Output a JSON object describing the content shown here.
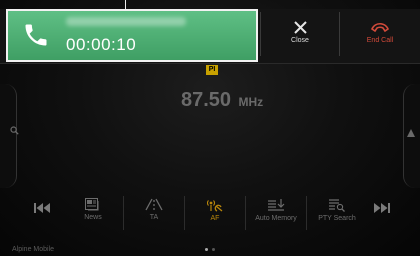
{
  "call": {
    "timer": "00:00:10"
  },
  "top_actions": {
    "close_label": "Close",
    "end_call_label": "End Call"
  },
  "radio": {
    "pi_badge": "PI",
    "frequency": "87.50",
    "unit": "MHz"
  },
  "functions": [
    {
      "label": "News",
      "icon": "news-icon",
      "active": false
    },
    {
      "label": "TA",
      "icon": "ta-icon",
      "active": false
    },
    {
      "label": "AF",
      "icon": "af-icon",
      "active": true
    },
    {
      "label": "Auto Memory",
      "icon": "auto-memory-icon",
      "active": false
    },
    {
      "label": "PTY Search",
      "icon": "pty-search-icon",
      "active": false
    }
  ],
  "pager": {
    "pages": 2,
    "current": 1
  },
  "footer": {
    "brand": "Alpine Mobile"
  },
  "colors": {
    "call_banner": "#4caf74",
    "end_call": "#d24a3a",
    "af_active": "#b8860b",
    "pi_badge": "#c8a100"
  }
}
